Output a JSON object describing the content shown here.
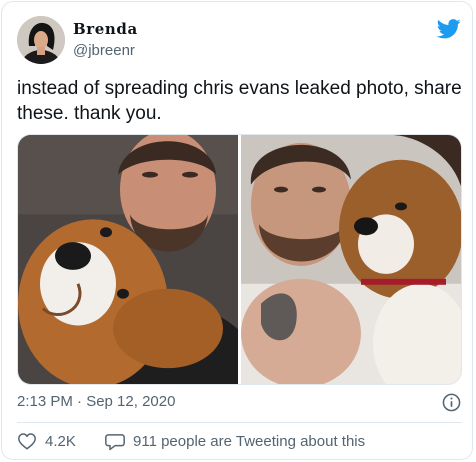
{
  "user": {
    "display_name": "Brenda",
    "handle": "@jbreenr"
  },
  "tweet": {
    "text": "instead of spreading chris evans leaked photo, share these. thank you.",
    "timestamp": "2:13 PM · Sep 12, 2020"
  },
  "stats": {
    "likes": "4.2K",
    "conversation": "911 people are Tweeting about this"
  },
  "colors": {
    "brand_blue": "#1d9bf0",
    "secondary_text": "#536471",
    "border": "#e1e8ed"
  },
  "icons": {
    "logo": "twitter-bird-icon",
    "info": "info-icon",
    "like": "heart-icon",
    "reply": "speech-bubble-icon"
  }
}
